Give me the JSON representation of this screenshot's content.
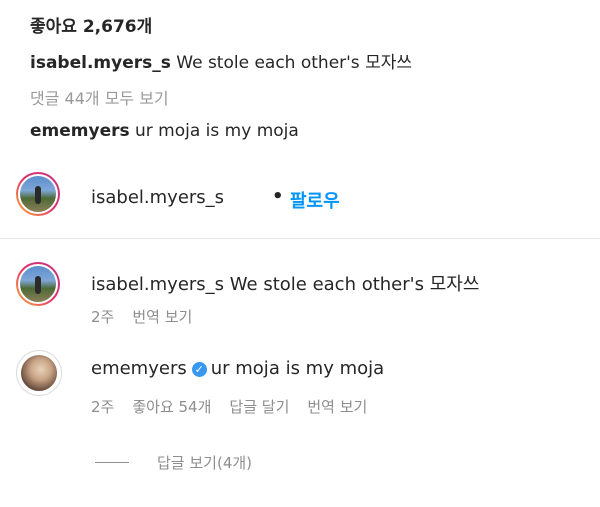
{
  "post": {
    "likes": "좋아요 2,676개",
    "caption_user": "isabel.myers_s",
    "caption_text": " We stole each other's 모자쓰",
    "view_all_comments": "댓글 44개 모두 보기",
    "preview_user": "ememyers",
    "preview_text": " ur moja is my moja"
  },
  "owner": {
    "username": "isabel.myers_s",
    "dot": "•",
    "follow_label": "팔로우"
  },
  "comments": [
    {
      "username": "isabel.myers_s",
      "text": " We stole each other's 모자쓰",
      "time": "2주",
      "translate": "번역 보기"
    },
    {
      "username": "ememyers",
      "verified_icon": "✓",
      "text": "ur moja is my moja",
      "time": "2주",
      "likes": "좋아요 54개",
      "reply": "답글 달기",
      "translate": "번역 보기"
    }
  ],
  "replies_toggle": "답글 보기(4개)",
  "colors": {
    "link": "#0095f6",
    "muted": "#8e8e8e",
    "verified": "#3897f0"
  }
}
